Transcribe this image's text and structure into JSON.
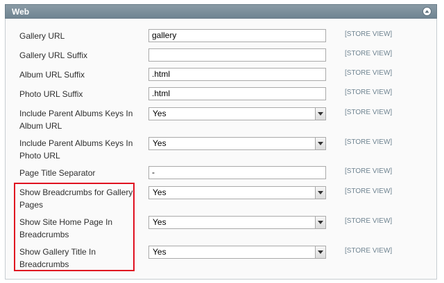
{
  "section": {
    "title": "Web",
    "collapse_icon": "collapse-up-icon"
  },
  "scope_label": "[STORE VIEW]",
  "fields": [
    {
      "label": "Gallery URL",
      "type": "text",
      "value": "gallery"
    },
    {
      "label": "Gallery URL Suffix",
      "type": "text",
      "value": ""
    },
    {
      "label": "Album URL Suffix",
      "type": "text",
      "value": ".html"
    },
    {
      "label": "Photo URL Suffix",
      "type": "text",
      "value": ".html"
    },
    {
      "label": "Include Parent Albums Keys In Album URL",
      "type": "select",
      "value": "Yes"
    },
    {
      "label": "Include Parent Albums Keys In Photo URL",
      "type": "select",
      "value": "Yes"
    },
    {
      "label": "Page Title Separator",
      "type": "text",
      "value": "-"
    },
    {
      "label": "Show Breadcrumbs for Gallery Pages",
      "type": "select",
      "value": "Yes"
    },
    {
      "label": "Show Site Home Page In Breadcrumbs",
      "type": "select",
      "value": "Yes"
    },
    {
      "label": "Show Gallery Title In Breadcrumbs",
      "type": "select",
      "value": "Yes"
    }
  ],
  "highlight_color": "#e01020"
}
